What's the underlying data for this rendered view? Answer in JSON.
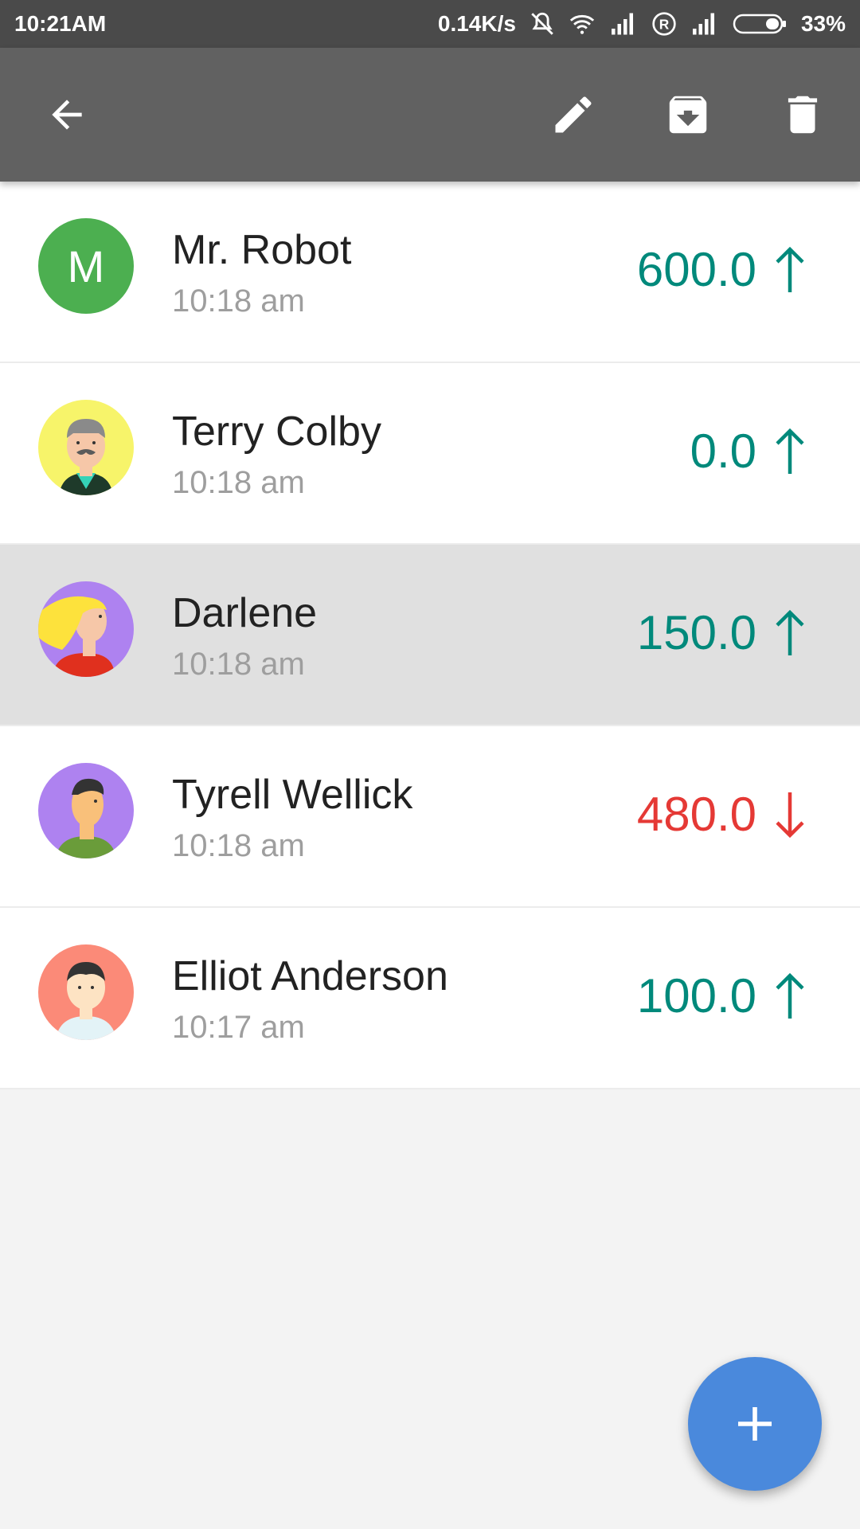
{
  "status_bar": {
    "time": "10:21AM",
    "network_speed": "0.14K/s",
    "battery": "33%",
    "icons": [
      "mute-icon",
      "wifi-icon",
      "signal-icon",
      "registered-icon",
      "signal-icon",
      "battery-icon"
    ]
  },
  "toolbar": {
    "icons": [
      "back-arrow-icon",
      "edit-pencil-icon",
      "archive-icon",
      "delete-trash-icon"
    ]
  },
  "colors": {
    "up": "#00897b",
    "down": "#e53935",
    "app_bar": "#616161",
    "fab": "#4a89dc"
  },
  "items": [
    {
      "name": "Mr. Robot",
      "time": "10:18 am",
      "amount": "600.0",
      "direction": "up",
      "avatar": "initial",
      "initial": "M"
    },
    {
      "name": "Terry Colby",
      "time": "10:18 am",
      "amount": "0.0",
      "direction": "up",
      "avatar": "old-man-avatar"
    },
    {
      "name": "Darlene",
      "time": "10:18 am",
      "amount": "150.0",
      "direction": "up",
      "avatar": "blonde-woman-avatar",
      "selected": true
    },
    {
      "name": "Tyrell Wellick",
      "time": "10:18 am",
      "amount": "480.0",
      "direction": "down",
      "avatar": "man-purple-avatar"
    },
    {
      "name": "Elliot Anderson",
      "time": "10:17 am",
      "amount": "100.0",
      "direction": "up",
      "avatar": "man-red-avatar"
    }
  ],
  "fab": {
    "icon": "plus-icon"
  }
}
